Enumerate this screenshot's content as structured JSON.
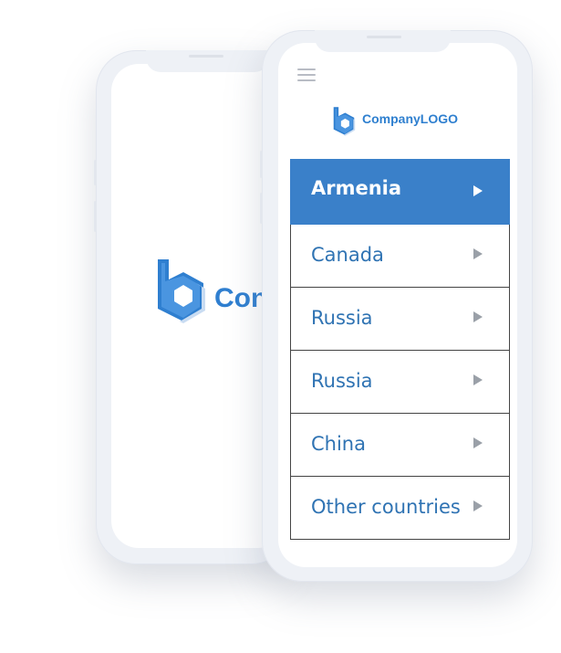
{
  "brand": {
    "logo_text": "CompanyLOGO",
    "splash_text_visible": "Con",
    "primary_color": "#3a80c9",
    "logo_color": "#2f7fd0"
  },
  "header": {
    "menu_icon": "hamburger-icon"
  },
  "countries": [
    {
      "label": "Armenia",
      "active": true
    },
    {
      "label": "Canada",
      "active": false
    },
    {
      "label": "Russia",
      "active": false
    },
    {
      "label": "Russia",
      "active": false
    },
    {
      "label": "China",
      "active": false
    },
    {
      "label": "Other countries",
      "active": false
    }
  ],
  "arrow_icon": "triangle-right-icon"
}
